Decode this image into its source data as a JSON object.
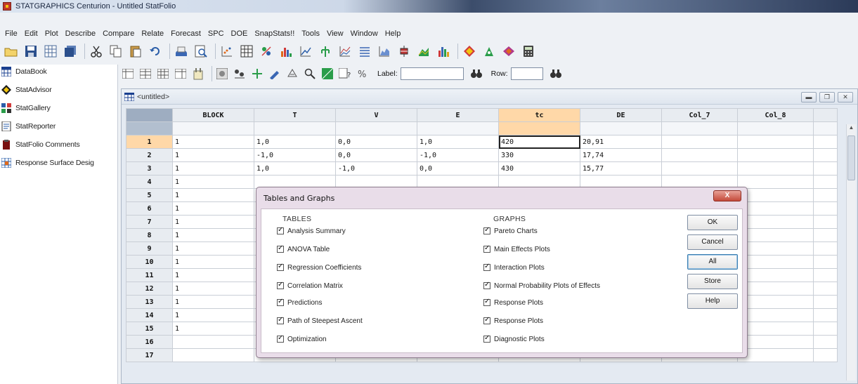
{
  "app": {
    "title": "STATGRAPHICS Centurion - Untitled StatFolio"
  },
  "menu": [
    "File",
    "Edit",
    "Plot",
    "Describe",
    "Compare",
    "Relate",
    "Forecast",
    "SPC",
    "DOE",
    "SnapStats!!",
    "Tools",
    "View",
    "Window",
    "Help"
  ],
  "sidebar": {
    "items": [
      {
        "label": "DataBook",
        "icon": "databook-icon"
      },
      {
        "label": "StatAdvisor",
        "icon": "statadvisor-icon"
      },
      {
        "label": "StatGallery",
        "icon": "statgallery-icon"
      },
      {
        "label": "StatReporter",
        "icon": "statreporter-icon"
      },
      {
        "label": "StatFolio Comments",
        "icon": "comments-icon"
      },
      {
        "label": "Response Surface Desig",
        "icon": "response-surface-icon"
      }
    ]
  },
  "toolbar2": {
    "label_label": "Label:",
    "row_label": "Row:",
    "label_value": "",
    "row_value": ""
  },
  "sheet": {
    "title": "<untitled>",
    "columns": [
      "BLOCK",
      "T",
      "V",
      "E",
      "tc",
      "DE",
      "Col_7",
      "Col_8"
    ],
    "active_column": 4,
    "current_row": 0,
    "row_numbers": [
      "1",
      "2",
      "3",
      "4",
      "5",
      "6",
      "7",
      "8",
      "9",
      "10",
      "11",
      "12",
      "13",
      "14",
      "15",
      "16",
      "17"
    ],
    "rows": [
      [
        "1",
        "1,0",
        "0,0",
        "1,0",
        "420",
        "20,91",
        "",
        ""
      ],
      [
        "1",
        "-1,0",
        "0,0",
        "-1,0",
        "330",
        "17,74",
        "",
        ""
      ],
      [
        "1",
        "1,0",
        "-1,0",
        "0,0",
        "430",
        "15,77",
        "",
        ""
      ],
      [
        "1",
        "",
        "",
        "",
        "",
        "",
        "",
        ""
      ],
      [
        "1",
        "",
        "",
        "",
        "",
        "",
        "",
        ""
      ],
      [
        "1",
        "",
        "",
        "",
        "",
        "",
        "",
        ""
      ],
      [
        "1",
        "",
        "",
        "",
        "",
        "",
        "",
        ""
      ],
      [
        "1",
        "",
        "",
        "",
        "",
        "",
        "",
        ""
      ],
      [
        "1",
        "",
        "",
        "",
        "",
        "",
        "",
        ""
      ],
      [
        "1",
        "",
        "",
        "",
        "",
        "",
        "",
        ""
      ],
      [
        "1",
        "",
        "",
        "",
        "",
        "",
        "",
        ""
      ],
      [
        "1",
        "",
        "",
        "",
        "",
        "",
        "",
        ""
      ],
      [
        "1",
        "",
        "",
        "",
        "",
        "",
        "",
        ""
      ],
      [
        "1",
        "",
        "",
        "",
        "",
        "",
        "",
        ""
      ],
      [
        "1",
        "",
        "",
        "",
        "",
        "",
        "",
        ""
      ],
      [
        "",
        "",
        "",
        "",
        "",
        "",
        "",
        ""
      ],
      [
        "",
        "",
        "",
        "",
        "",
        "",
        "",
        ""
      ]
    ]
  },
  "dialog": {
    "title": "Tables and Graphs",
    "close_label": "X",
    "tables_heading": "TABLES",
    "graphs_heading": "GRAPHS",
    "tables": [
      "Analysis Summary",
      "ANOVA Table",
      "Regression Coefficients",
      "Correlation Matrix",
      "Predictions",
      "Path of Steepest Ascent",
      "Optimization"
    ],
    "graphs": [
      "Pareto Charts",
      "Main Effects Plots",
      "Interaction Plots",
      "Normal Probability Plots of Effects",
      "Response Plots",
      "Response Plots",
      "Diagnostic Plots"
    ],
    "buttons": {
      "ok": "OK",
      "cancel": "Cancel",
      "all": "All",
      "store": "Store",
      "help": "Help"
    }
  },
  "colors": {
    "accent_active_column": "#ffd8a8",
    "dialog_background": "#e9dde9",
    "close_button": "#c44a3a"
  }
}
